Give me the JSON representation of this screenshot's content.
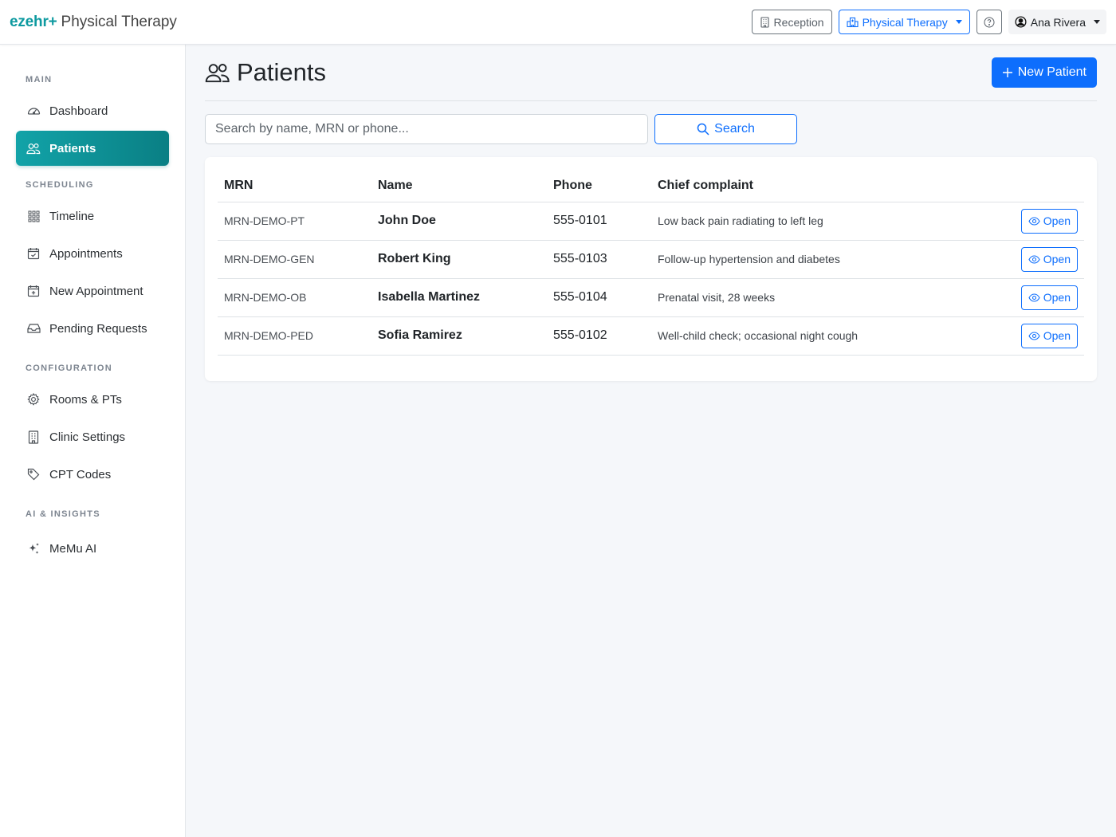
{
  "header": {
    "brand_logo": "ezehr+",
    "brand_subtitle": "Physical Therapy",
    "reception_label": "Reception",
    "clinic_label": "Physical Therapy",
    "user_name": "Ana Rivera",
    "icons": {
      "reception": "building-icon",
      "clinic": "hospital-icon",
      "help": "question-circle-icon",
      "user": "person-circle-icon"
    }
  },
  "sidebar": {
    "sections": {
      "main": "MAIN",
      "scheduling": "SCHEDULING",
      "configuration": "CONFIGURATION",
      "ai": "AI & INSIGHTS"
    },
    "items": {
      "dashboard": "Dashboard",
      "patients": "Patients",
      "timeline": "Timeline",
      "appointments": "Appointments",
      "new_appointment": "New Appointment",
      "pending_requests": "Pending Requests",
      "rooms": "Rooms & PTs",
      "clinic_settings": "Clinic Settings",
      "cpt_codes": "CPT Codes",
      "memu_ai": "MeMu AI"
    },
    "active": "patients"
  },
  "page": {
    "title": "Patients",
    "new_patient_label": "New Patient"
  },
  "search": {
    "placeholder": "Search by name, MRN or phone...",
    "value": "",
    "button_label": "Search"
  },
  "table": {
    "columns": {
      "mrn": "MRN",
      "name": "Name",
      "phone": "Phone",
      "chief_complaint": "Chief complaint"
    },
    "rows": [
      {
        "mrn": "MRN-DEMO-PT",
        "name": "John Doe",
        "phone": "555-0101",
        "chief_complaint": "Low back pain radiating to left leg",
        "action": "Open"
      },
      {
        "mrn": "MRN-DEMO-GEN",
        "name": "Robert King",
        "phone": "555-0103",
        "chief_complaint": "Follow-up hypertension and diabetes",
        "action": "Open"
      },
      {
        "mrn": "MRN-DEMO-OB",
        "name": "Isabella Martinez",
        "phone": "555-0104",
        "chief_complaint": "Prenatal visit, 28 weeks",
        "action": "Open"
      },
      {
        "mrn": "MRN-DEMO-PED",
        "name": "Sofia Ramirez",
        "phone": "555-0102",
        "chief_complaint": "Well-child check; occasional night cough",
        "action": "Open"
      }
    ]
  },
  "colors": {
    "brand_teal": "#0e9aa0",
    "primary_blue": "#0d6efd",
    "active_gradient_start": "#12a3a8",
    "active_gradient_end": "#0a7f84"
  }
}
